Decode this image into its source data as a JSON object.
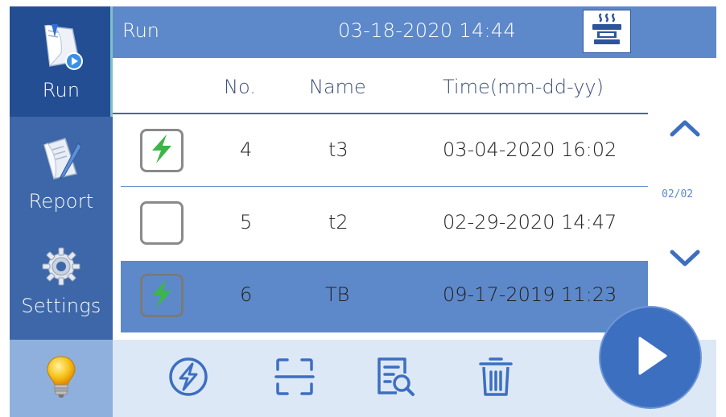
{
  "sidebar": {
    "items": [
      {
        "label": "Run",
        "icon": "run-document-icon"
      },
      {
        "label": "Report",
        "icon": "report-pen-icon"
      },
      {
        "label": "Settings",
        "icon": "gear-icon"
      },
      {
        "label": "",
        "icon": "lightbulb-icon"
      }
    ]
  },
  "header": {
    "title": "Run",
    "datetime": "03-18-2020 14:44",
    "heater_icon": "heated-lid-icon"
  },
  "table": {
    "columns": [
      "No.",
      "Name",
      "Time(mm-dd-yy)"
    ],
    "rows": [
      {
        "checked": true,
        "no": "4",
        "name": "t3",
        "time": "03-04-2020 16:02",
        "selected": false
      },
      {
        "checked": false,
        "no": "5",
        "name": "t2",
        "time": "02-29-2020 14:47",
        "selected": false
      },
      {
        "checked": true,
        "no": "6",
        "name": "TB",
        "time": "09-17-2019 11:23",
        "selected": true
      }
    ]
  },
  "pager": {
    "indicator": "02/02"
  },
  "toolbar": {
    "tools": [
      "lightning-icon",
      "scan-icon",
      "search-document-icon",
      "trash-icon"
    ],
    "play_icon": "play-icon"
  },
  "colors": {
    "sidebar": "#3d67a8",
    "sidebar_active": "#234e94",
    "header": "#5d89ca",
    "selected_row": "#5d89ca",
    "toolbar": "#dde8f6",
    "check_green": "#3cb54a",
    "accent": "#2d559c"
  }
}
